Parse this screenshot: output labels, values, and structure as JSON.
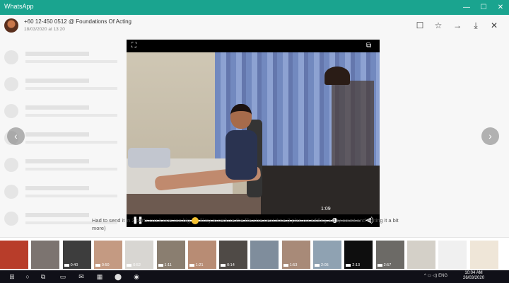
{
  "window": {
    "title": "WhatsApp",
    "controls": [
      "—",
      "☐",
      "✕"
    ]
  },
  "header": {
    "sender": "+60 12-450 0512 @ Foundations Of Acting",
    "datetime": "18/03/2020 at 13:20",
    "actions": [
      {
        "name": "comment-icon",
        "glyph": "☐"
      },
      {
        "name": "star-icon",
        "glyph": "☆"
      },
      {
        "name": "forward-icon",
        "glyph": "→"
      },
      {
        "name": "download-icon",
        "glyph": "⤓"
      },
      {
        "name": "close-icon",
        "glyph": "✕"
      }
    ]
  },
  "nav": {
    "prev": "‹",
    "next": "›"
  },
  "video": {
    "time": "1:09",
    "progress_fraction": 0.88,
    "play_glyph": "❚❚",
    "volume_glyph": "◀)",
    "fullscreen_glyph": "⛶",
    "popout_glyph": "⧉"
  },
  "caption": {
    "before_emoji": "Had to send it in 2 parts cuz it was too big",
    "after_emoji": "ill try to reduze the file size next time (I plan on adding a day count and editing it a bit more)"
  },
  "thumbnails": [
    {
      "color": "#b83d2a",
      "label": ""
    },
    {
      "color": "#7c7470",
      "label": ""
    },
    {
      "color": "#3d3d3d",
      "label": "0:40"
    },
    {
      "color": "#c49a82",
      "label": "0:50"
    },
    {
      "color": "#d8d6d2",
      "label": "0:52"
    },
    {
      "color": "#8a7e70",
      "label": "1:11"
    },
    {
      "color": "#b88c74",
      "label": "1:21"
    },
    {
      "color": "#4f4a46",
      "label": "0:14"
    },
    {
      "color": "#7f8d9c",
      "label": ""
    },
    {
      "color": "#a88a78",
      "label": "1:53"
    },
    {
      "color": "#8fa2b2",
      "label": "2:05"
    },
    {
      "color": "#0e0e0e",
      "label": "2:13"
    },
    {
      "color": "#6c6a66",
      "label": "2:57"
    },
    {
      "color": "#d4d0c8",
      "label": ""
    },
    {
      "color": "#f0f0f0",
      "label": ""
    },
    {
      "color": "#efe6d8",
      "label": ""
    }
  ],
  "taskbar": {
    "items": [
      "⊞",
      "○",
      "⧉",
      "▭",
      "✉",
      "▦",
      "⬤",
      "◉"
    ],
    "tray": "^  ▭  ◁)  ENG",
    "time": "10:04 AM",
    "date": "26/03/2020"
  },
  "colors": {
    "titlebar": "#1aa48f",
    "taskbar": "#101018"
  }
}
